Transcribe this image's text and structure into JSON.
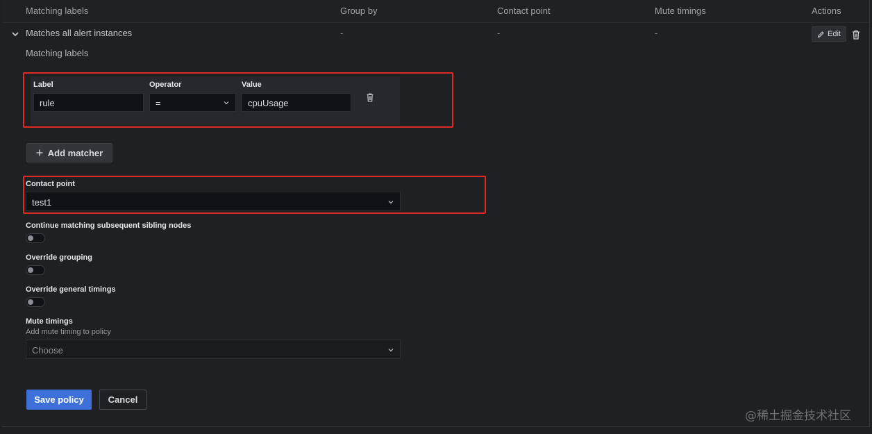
{
  "table": {
    "headers": [
      "Matching labels",
      "Group by",
      "Contact point",
      "Mute timings",
      "Actions"
    ],
    "row": {
      "matching_labels": "Matches all alert instances",
      "group_by": "-",
      "contact_point": "-",
      "mute_timings": "-",
      "edit_label": "Edit"
    }
  },
  "form": {
    "section_title": "Matching labels",
    "matcher": {
      "label_title": "Label",
      "label_value": "rule",
      "operator_title": "Operator",
      "operator_value": "=",
      "value_title": "Value",
      "value_value": "cpuUsage"
    },
    "add_matcher_label": "Add matcher",
    "contact_point": {
      "title": "Contact point",
      "value": "test1"
    },
    "continue_matching": {
      "title": "Continue matching subsequent sibling nodes",
      "enabled": false
    },
    "override_grouping": {
      "title": "Override grouping",
      "enabled": false
    },
    "override_timings": {
      "title": "Override general timings",
      "enabled": false
    },
    "mute_timings": {
      "title": "Mute timings",
      "description": "Add mute timing to policy",
      "placeholder": "Choose"
    },
    "save_label": "Save policy",
    "cancel_label": "Cancel"
  },
  "watermark": "@稀土掘金技术社区",
  "colors": {
    "primary": "#3d71d9",
    "highlight": "#e02a26",
    "background": "#1f2024"
  }
}
